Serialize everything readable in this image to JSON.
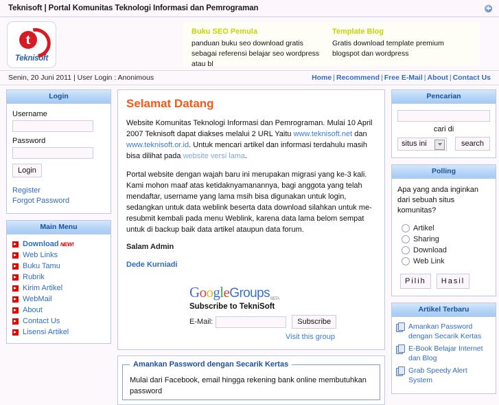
{
  "window": {
    "title": "Teknisoft | Portal Komunitas Teknologi Informasi dan Pemrograman",
    "close_icon": "close-round-icon"
  },
  "header": {
    "logo_letter": "t",
    "logo_word": "Teknisoft",
    "ads": [
      {
        "title": "Buku SEO Pemula",
        "body": "panduan buku seo download gratis sebagai referensi belajar seo wordpress atau bl"
      },
      {
        "title": "Template Blog",
        "body": "Gratis download template premium blogspot dan wordpress"
      }
    ],
    "ad_title_color": "#c3d400"
  },
  "infobar": {
    "date_user": "Senin, 20 Juni 2011 | User Login : Anonimous",
    "nav": [
      "Home",
      "Recommend",
      "Free E-Mail",
      "About",
      "Contact Us"
    ],
    "separator": "|"
  },
  "left": {
    "login_panel": {
      "title": "Login",
      "username_label": "Username",
      "username_value": "",
      "username_placeholder": "",
      "password_label": "Password",
      "password_value": "",
      "password_placeholder": "",
      "submit_label": "Login",
      "links": [
        "Register",
        "Forgot Password"
      ]
    },
    "menu_panel": {
      "title": "Main Menu",
      "items": [
        {
          "label": "Download",
          "badge": "NEW!"
        },
        {
          "label": "Web Links",
          "badge": ""
        },
        {
          "label": "Buku Tamu",
          "badge": ""
        },
        {
          "label": "Rubrik",
          "badge": ""
        },
        {
          "label": "Kirim Artikel",
          "badge": ""
        },
        {
          "label": "WebMail",
          "badge": ""
        },
        {
          "label": "About",
          "badge": ""
        },
        {
          "label": "Contact Us",
          "badge": ""
        },
        {
          "label": "Lisensi Artikel",
          "badge": ""
        }
      ]
    }
  },
  "center": {
    "heading": "Selamat Datang",
    "p1_a": "Website Komunitas Teknologi Informasi dan Pemrograman. Mulai 10 April 2007 Teknisoft dapat diakses melalui 2 URL Yaitu ",
    "p1_link1": "www.teknisoft.net",
    "p1_b": " dan ",
    "p1_link2": "www.teknisoft.or.id",
    "p1_c": ". Untuk mencari artikel dan informasi terdahulu masih bisa dilihat pada ",
    "p1_link3": "website versi lama",
    "p1_d": ".",
    "p2": "Portal website dengan wajah baru ini merupakan migrasi yang ke-3 kali. Kami mohon maaf atas ketidaknyamanannya, bagi anggota yang telah mendaftar, username yang lama msih bisa digunakan untuk login, sedangkan untuk data  weblink beserta data download silahkan untuk me-resubmit kembali pada menu Weblink, karena data lama belom sempat untuk di backup baik data artikel ataupun data forum.",
    "signature_title": "Salam Admin",
    "signature_name": "Dede Kurniadi",
    "google_groups": {
      "logo_g1": "G",
      "logo_o1": "o",
      "logo_o2": "o",
      "logo_g2": "g",
      "logo_l": "l",
      "logo_e": "e",
      "logo_groups": "Groups",
      "logo_beta": "BETA",
      "subscribe_title": "Subscribe to TekniSoft",
      "email_label": "E-Mail:",
      "email_value": "",
      "email_placeholder": "",
      "subscribe_button": "Subscribe",
      "visit_link": "Visit this group"
    },
    "article": {
      "legend": "Amankan Password dengan Secarik Kertas",
      "body": "Mulai dari Facebook, email hingga rekening bank online membutuhkan password"
    }
  },
  "right": {
    "search_panel": {
      "title": "Pencarian",
      "query_value": "",
      "query_placeholder": "",
      "scope_label": "cari di",
      "scope_selected": "situs ini",
      "scope_options": [
        "situs ini"
      ],
      "button_label": "search"
    },
    "poll_panel": {
      "title": "Polling",
      "question": "Apa yang anda inginkan dari sebuah situs komunitas?",
      "options": [
        "Artikel",
        "Sharing",
        "Download",
        "Web Link"
      ],
      "vote_button": "Pilih",
      "results_button": "Hasil"
    },
    "articles_panel": {
      "title": "Artikel Terbaru",
      "items": [
        "Amankan Password dengan Secarik Kertas",
        "E-Book Belajar Internet dan Blog",
        "Grab Speedy Alert System"
      ]
    }
  }
}
